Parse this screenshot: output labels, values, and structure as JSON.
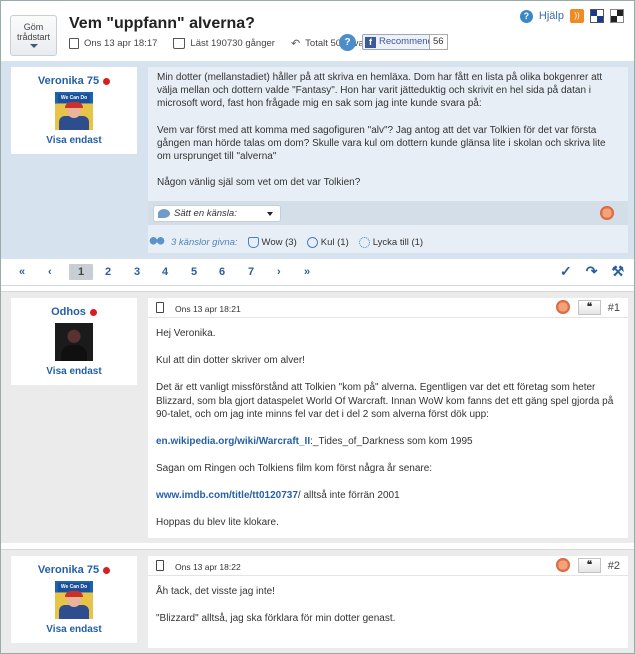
{
  "header": {
    "hide_start_line1": "Göm",
    "hide_start_line2": "trådstart",
    "title": "Vem \"uppfann\" alverna?",
    "date": "Ons 13 apr 18:17",
    "read": "Läst 190730 gånger",
    "total_replies": "Totalt 501 svar",
    "help_icon": "?",
    "recommend_label": "Recommend",
    "recommend_count": "56",
    "help_link": "Hjälp"
  },
  "question": {
    "author": "Veronika 75",
    "avatar_text": "We Can Do It!",
    "show_only": "Visa endast",
    "paragraphs": [
      "Min dotter (mellanstadiet) håller på att skriva en hemläxa. Dom har fått en lista på olika bokgenrer att välja mellan och dottern valde \"Fantasy\". Hon har varit jätteduktig och skrivit en hel sida på datan i microsoft word, fast hon frågade mig en sak som jag inte kunde svara på:",
      "Vem var först med att komma med sagofiguren \"alv\"? Jag antog att det var Tolkien för det var första gången man hörde talas om dom? Skulle vara kul om dottern kunde glänsa lite i skolan och skriva lite om ursprunget till \"alverna\"",
      "Någon vänlig själ som vet om det var Tolkien?"
    ],
    "feeling_select": "Sätt en känsla:",
    "feelings_given": "3 känslor givna:",
    "feelings": [
      {
        "icon": "trophy-icon",
        "label": "Wow (3)"
      },
      {
        "icon": "smile-icon",
        "label": "Kul (1)"
      },
      {
        "icon": "sun-icon",
        "label": "Lycka till (1)"
      }
    ]
  },
  "pager": {
    "first": "«",
    "prev": "‹",
    "pages": [
      "1",
      "2",
      "3",
      "4",
      "5",
      "6",
      "7"
    ],
    "current": "1",
    "next": "›",
    "last": "»",
    "tools": [
      "✓",
      "↷",
      "⚒"
    ]
  },
  "posts": [
    {
      "author": "Odhos",
      "show_only": "Visa endast",
      "date": "Ons 13 apr 18:21",
      "quote": "❝",
      "number": "#1",
      "greeting": "Hej Veronika.",
      "line2": "Kul att din dotter skriver om alver!",
      "line3": "Det är ett vanligt missförstånd att Tolkien \"kom på\" alverna. Egentligen var det ett företag som heter Blizzard, som bla gjort dataspelet World Of Warcraft. Innan WoW kom fanns det ett gäng spel gjorda på 90-talet, och om jag inte minns fel var det i del 2 som alverna först dök upp:",
      "link1": "en.wikipedia.org/wiki/Warcraft_II",
      "link1_rest": ":_Tides_of_Darkness  som kom 1995",
      "line5": "Sagan om Ringen och Tolkiens film kom först några år senare:",
      "link2": "www.imdb.com/title/tt0120737",
      "link2_rest": "/  alltså inte förrän 2001",
      "line7": "Hoppas du blev lite klokare."
    },
    {
      "author": "Veronika 75",
      "avatar_text": "We Can Do It!",
      "show_only": "Visa endast",
      "date": "Ons 13 apr 18:22",
      "quote": "❝",
      "number": "#2",
      "line1": "Åh tack, det visste jag inte!",
      "line2": "\"Blizzard\" alltså, jag ska förklara för min dotter genast."
    }
  ]
}
